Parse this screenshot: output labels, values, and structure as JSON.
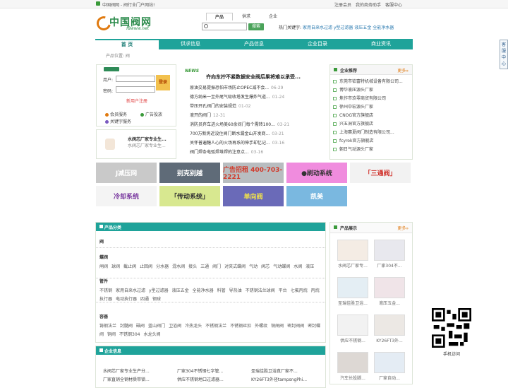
{
  "topbar": {
    "slogan": "中国阀网 - 阀行业门户网站!",
    "links": [
      "注册会员",
      "我的商务助手",
      "客服中心"
    ]
  },
  "logo": {
    "cn": "中国阀网",
    "en": "f8www.net",
    "badge": "FA"
  },
  "search": {
    "tabs": [
      "产品",
      "供求",
      "企业"
    ],
    "button": "搜索",
    "hot_label": "热门关键字:",
    "hot_keywords": "家用自来水过滤 y型过滤器 液压五金 全能净水器"
  },
  "nav": [
    "首 页",
    "供求信息",
    "产品信息",
    "企业目录",
    "商业资讯"
  ],
  "crumb": "产品位置: 阀",
  "login": {
    "user_label": "用户:",
    "pass_label": "密码:",
    "login_btn": "登录",
    "register": "新用户注册",
    "services": [
      "会员服务",
      "广告投放",
      "关键字服务"
    ]
  },
  "ad_left": {
    "title": "水阀芯厂家专业生...",
    "sub": "水阀芯厂家专业生..."
  },
  "news": {
    "tag": "NEWS",
    "headline": "齐向东拧不紧数据安全阀后果将难以承受...",
    "items": [
      {
        "t": "原油交易提振恐怕市场防止OPEC减不会...",
        "d": "06-29"
      },
      {
        "t": "德方纳米一至外尾气吸收塔发生爆炸气道...",
        "d": "01-24"
      },
      {
        "t": "带压开孔阀门的安装规范",
        "d": "01-02"
      },
      {
        "t": "液开的阀门",
        "d": "12-31"
      },
      {
        "t": "消防员弃车进火场美60余间门每个需转100...",
        "d": "03-21"
      },
      {
        "t": "700万新房近没住阀门断水漏金山开发商...",
        "d": "03-21"
      },
      {
        "t": "关怀普遍糖人心的火场再系的伸手却忆记...",
        "d": "03-16"
      },
      {
        "t": "阀门焊条电弧焊堆焊的注意点...",
        "d": "03-16"
      }
    ]
  },
  "recommend": {
    "title": "企业推荐",
    "more": "更多»",
    "items": [
      "东莞市铂富特机械设备有限公司...",
      "博华液压源头厂家",
      "焦作市玖零商贸有限公司",
      "徐州中宏源头厂家",
      "CNOG官方旗舰店",
      "兴五洲官方旗舰店",
      "上海赛夏阀门制造有限公司...",
      "fcyrok官方旗舰店",
      "朝日气动源头厂家"
    ]
  },
  "banners": [
    {
      "text": "J减压网",
      "bg": "#c9c9c9",
      "fg": "#ffffff"
    },
    {
      "text": "别克别越",
      "bg": "#5f6b78",
      "fg": "#ffffff"
    },
    {
      "text": "广告招租 400-703-2221",
      "bg": "#b8bdc0",
      "fg": "#d23a2a"
    },
    {
      "text": "●刷动系统",
      "bg": "#f08cde",
      "fg": "#333333"
    },
    {
      "text": "「三通阀」",
      "bg": "#f2f2f2",
      "fg": "#d0302a"
    },
    {
      "text": "冷却系统",
      "bg": "#f4f4f4",
      "fg": "#7a3aa0"
    },
    {
      "text": "「传动系统」",
      "bg": "#d8e890",
      "fg": "#333333"
    },
    {
      "text": "单向阀",
      "bg": "#6a6ab8",
      "fg": "#f2e24a"
    },
    {
      "text": "凯美",
      "bg": "#7ab8e0",
      "fg": "#ffffff"
    }
  ],
  "categories": {
    "title": "产品分类",
    "groups": [
      {
        "name": "阀",
        "items": []
      },
      {
        "name": "蝶阀",
        "items": [
          "闸阀",
          "球阀",
          "截止阀",
          "止回阀",
          "分水器",
          "混水阀",
          "接头",
          "三通",
          "阀门",
          "对夹式蝶阀",
          "气动",
          "阀芯",
          "气动蝶阀",
          "水阀",
          "液压"
        ]
      },
      {
        "name": "管件",
        "items": [
          "不锈钢",
          "家用自来水过滤",
          "y型过滤器",
          "液压五金",
          "全能净水器",
          "料管",
          "导热油",
          "不锈钢法兰球阀",
          "平台",
          "七氟丙烷",
          "丙烷",
          "执行器",
          "电动执行器",
          "四通",
          "钢球"
        ]
      },
      {
        "name": "容器",
        "items": [
          "铸钢法兰",
          "封髓阀",
          "磁阀",
          "蓝山阀门",
          "卫浴阀",
          "冷热龙头",
          "不锈钢法兰",
          "不锈钢丝扣",
          "外螺纹",
          "铜闸阀",
          "密封阀阀",
          "密封蝶阀",
          "铜阀",
          "不锈钢304",
          "水龙头阀"
        ]
      }
    ]
  },
  "companies": {
    "title": "企业信息",
    "rows": [
      [
        "水阀芯厂家专业生产分...",
        "厂家304不锈钢七字管...",
        "圣瑞佳胜卫浴真厂家不..."
      ],
      [
        "厂家直销全钢材质带锁...",
        "供应不锈钢地口过滤器...",
        "KY26FT3外径tampsngPhi..."
      ]
    ]
  },
  "products": {
    "title": "产品展示",
    "more": "更多»",
    "items": [
      "水阀芯厂家专...",
      "厂家304不...",
      "圣瑞佳胜卫浴...",
      "液压五金...",
      "供应不锈钢...",
      "KY26FT3外...",
      "汽车长投脚...",
      "厂家自动..."
    ]
  },
  "side_float": "客服中心",
  "qr_caption": "手机访问"
}
